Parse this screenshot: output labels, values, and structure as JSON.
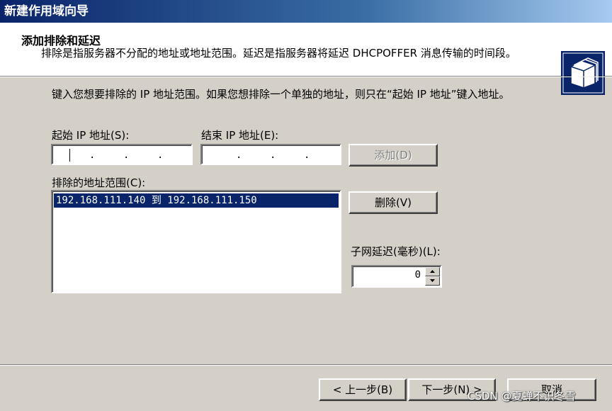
{
  "window": {
    "title": "新建作用域向导"
  },
  "header": {
    "title": "添加排除和延迟",
    "description": "排除是指服务器不分配的地址或地址范围。延迟是指服务器将延迟 DHCPOFFER 消息传输的时间段。",
    "icon": "folder-wizard-icon"
  },
  "form": {
    "instruction": "键入您想要排除的 IP 地址范围。如果您想排除一个单独的地址，则只在“起始 IP 地址”键入地址。",
    "start_ip_label": "起始 IP 地址(S):",
    "end_ip_label": "结束 IP 地址(E):",
    "start_ip_value": "",
    "end_ip_value": "",
    "add_button": "添加(D)",
    "excluded_ranges_label": "排除的地址范围(C):",
    "excluded_ranges": [
      "192.168.111.140 到 192.168.111.150"
    ],
    "remove_button": "删除(V)",
    "subnet_delay_label": "子网延迟(毫秒)(L):",
    "subnet_delay_value": "0"
  },
  "footer": {
    "back_button": "< 上一步(B)",
    "next_button": "下一步(N) >",
    "cancel_button": "取消"
  },
  "watermark": "CSDN @夏蝉不识冬雪",
  "colors": {
    "selection": "#0a246a",
    "face": "#d4d0c8",
    "title_start": "#0a246a"
  }
}
